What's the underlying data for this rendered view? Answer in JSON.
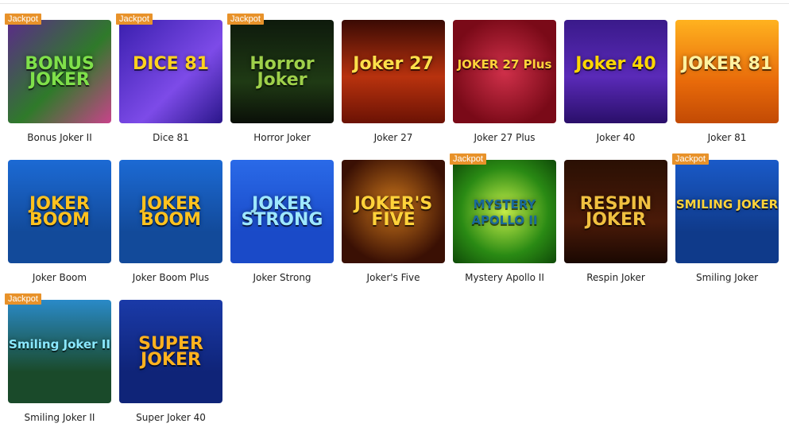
{
  "badge_label": "Jackpot",
  "games": [
    {
      "name": "Bonus Joker II",
      "jackpot": true,
      "logo": "BONUS JOKER",
      "bg": "linear-gradient(135deg,#5b2a8a,#2f7a2a 55%,#c8438a)",
      "logo_color": "#7fe04a"
    },
    {
      "name": "Dice 81",
      "jackpot": true,
      "logo": "DICE 81",
      "bg": "linear-gradient(135deg,#3a1fae,#7d4be8 60%,#2a168a)",
      "logo_color": "#ffd21f"
    },
    {
      "name": "Horror Joker",
      "jackpot": true,
      "logo": "Horror Joker",
      "bg": "linear-gradient(180deg,#0e1a0c,#1f3a14 60%,#0a0f08)",
      "logo_color": "#9ed04a"
    },
    {
      "name": "Joker 27",
      "jackpot": false,
      "logo": "Joker 27",
      "bg": "linear-gradient(180deg,#3a0a04,#b8320e 55%,#6b1204)",
      "logo_color": "#ffe04a"
    },
    {
      "name": "Joker 27 Plus",
      "jackpot": false,
      "logo": "JOKER 27 Plus",
      "bg": "radial-gradient(circle at 50% 50%,#d0304a,#7a0a18 75%)",
      "logo_color": "#ffd23a"
    },
    {
      "name": "Joker 40",
      "jackpot": false,
      "logo": "Joker 40",
      "bg": "linear-gradient(180deg,#3a1a8a,#5a2ab8 55%,#2a0f6a)",
      "logo_color": "#ffd700"
    },
    {
      "name": "Joker 81",
      "jackpot": false,
      "logo": "JOKER 81",
      "bg": "linear-gradient(180deg,#ffb21f,#e86a0a 60%,#c24a04)",
      "logo_color": "#fff2a0"
    },
    {
      "name": "Joker Boom",
      "jackpot": false,
      "logo": "JOKER BOOM",
      "bg": "linear-gradient(180deg,#1c6ad4,#124a9a 70%)",
      "logo_color": "#ffc21f"
    },
    {
      "name": "Joker Boom Plus",
      "jackpot": false,
      "logo": "JOKER BOOM",
      "bg": "linear-gradient(180deg,#1c6ad4,#124a9a 70%)",
      "logo_color": "#ffc21f"
    },
    {
      "name": "Joker Strong",
      "jackpot": false,
      "logo": "JOKER STRONG",
      "bg": "linear-gradient(180deg,#2a6ae8,#1a4ac8 70%)",
      "logo_color": "#9ee8ff"
    },
    {
      "name": "Joker's Five",
      "jackpot": false,
      "logo": "JOKER'S FIVE",
      "bg": "radial-gradient(circle at 50% 45%,#c8741a,#3a1004 75%)",
      "logo_color": "#ffd23a"
    },
    {
      "name": "Mystery Apollo II",
      "jackpot": true,
      "logo": "MYSTERY APOLLO II",
      "bg": "radial-gradient(circle at 50% 50%,#c8f04a,#2a8a14 60%,#0f4a08)",
      "logo_color": "#1a6a9a"
    },
    {
      "name": "Respin Joker",
      "jackpot": false,
      "logo": "RESPIN JOKER",
      "bg": "linear-gradient(180deg,#2a1004,#4a1a08 60%,#1a0802)",
      "logo_color": "#f0c040"
    },
    {
      "name": "Smiling Joker",
      "jackpot": true,
      "logo": "SMILING JOKER",
      "bg": "linear-gradient(180deg,#1a5ac8,#0f3a8a 70%)",
      "logo_color": "#ffd23a"
    },
    {
      "name": "Smiling Joker II",
      "jackpot": true,
      "logo": "Smiling Joker II",
      "bg": "linear-gradient(180deg,#2a8ac8,#1a4a2a 70%)",
      "logo_color": "#8ae8ff"
    },
    {
      "name": "Super Joker 40",
      "jackpot": false,
      "logo": "SUPER JOKER",
      "bg": "linear-gradient(180deg,#1a3aa8,#0f2478 70%)",
      "logo_color": "#ffb21f"
    }
  ]
}
